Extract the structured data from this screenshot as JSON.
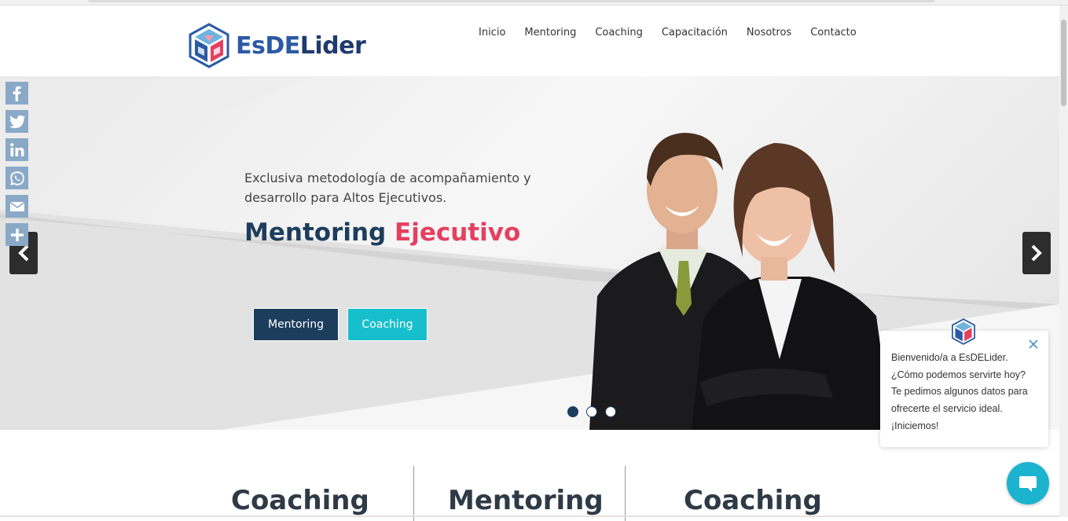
{
  "brand": {
    "name_prefix": "EsDE",
    "name_suffix": "Lider",
    "logo_icon": "esdelider-cube-logo"
  },
  "nav": [
    {
      "label": "Inicio"
    },
    {
      "label": "Mentoring"
    },
    {
      "label": "Coaching"
    },
    {
      "label": "Capacitación"
    },
    {
      "label": "Nosotros"
    },
    {
      "label": "Contacto"
    }
  ],
  "share": [
    {
      "icon": "facebook-icon"
    },
    {
      "icon": "twitter-icon"
    },
    {
      "icon": "linkedin-icon"
    },
    {
      "icon": "whatsapp-icon"
    },
    {
      "icon": "email-icon"
    },
    {
      "icon": "plus-icon"
    }
  ],
  "hero": {
    "subtitle": "Exclusiva metodología de acompañamiento y desarrollo para Altos Ejecutivos.",
    "title_part1": "Mentoring",
    "title_part2": "Ejecutivo",
    "button_primary": "Mentoring",
    "button_secondary": "Coaching",
    "slide_count": 3,
    "active_slide": 1
  },
  "sections": [
    {
      "title": "Coaching"
    },
    {
      "title": "Mentoring"
    },
    {
      "title": "Coaching"
    }
  ],
  "chat": {
    "line1": "Bienvenido/a a EsDELider.",
    "line2": "¿Cómo podemos servirte hoy?",
    "line3": "Te pedimos algunos datos para",
    "line4": "ofrecerte el servicio ideal.",
    "line5": "¡Iniciemos!"
  },
  "colors": {
    "navy": "#1d3d5c",
    "pink": "#e4405f",
    "teal": "#17bfcc",
    "share_blue": "#8aa9c7",
    "chat_teal": "#1cb3cf"
  }
}
